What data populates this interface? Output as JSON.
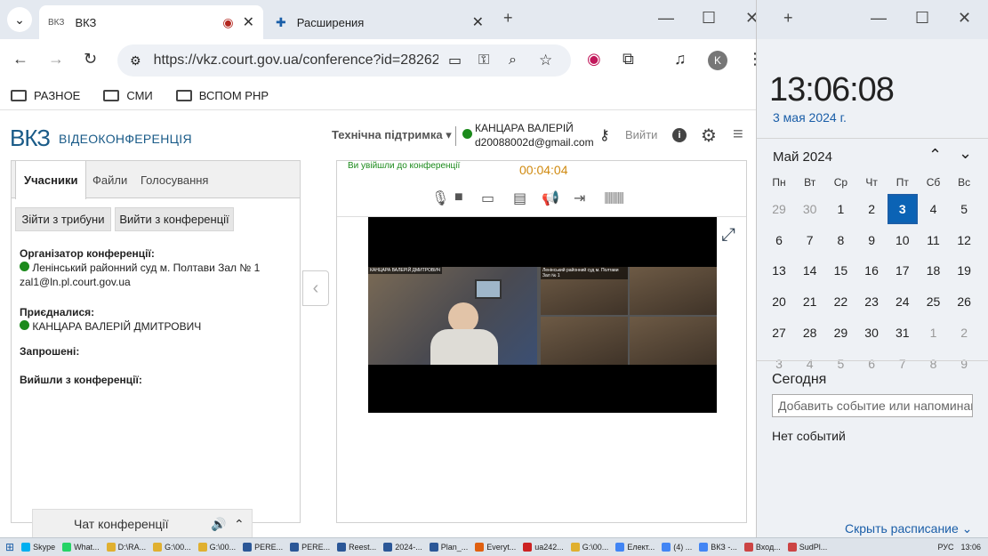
{
  "browser": {
    "tabs": [
      {
        "favicon": "ВКЗ",
        "title": "ВКЗ",
        "active": true
      },
      {
        "favicon": "puzzle-icon",
        "title": "Расширения",
        "active": false
      }
    ],
    "url": "https://vkz.court.gov.ua/conference?id=28262...",
    "profile_initial": "K",
    "bookmarks": [
      "РАЗНОЕ",
      "СМИ",
      "ВСПОМ РНР"
    ]
  },
  "header": {
    "logo": "ВКЗ",
    "logo_sub": "ВІДЕОКОНФЕРЕНЦІЯ",
    "support": "Технічна підтримка ▾",
    "user_name": "КАНЦАРА ВАЛЕРІЙ",
    "user_email": "d20088002d@gmail.com",
    "logout": "Вийти"
  },
  "participants_panel": {
    "tabs": [
      "Учасники",
      "Файли",
      "Голосування"
    ],
    "btn_leave_tribune": "Зійти з трибуни",
    "btn_leave_conf": "Вийти з конференції",
    "organizer_label": "Організатор конференції:",
    "organizer_name": "Ленінський районний суд м. Полтави Зал № 1",
    "organizer_email": "zal1@ln.pl.court.gov.ua",
    "joined_label": "Приєдналися:",
    "joined_name": "КАНЦАРА ВАЛЕРІЙ ДМИТРОВИЧ",
    "invited_label": "Запрошені:",
    "left_label": "Вийшли з конференції:"
  },
  "conference": {
    "status": "Ви увійшли до конференції",
    "timer": "00:04:04",
    "cam_label_self": "КАНЦАРА ВАЛЕРІЙ ДМИТРОВИЧ",
    "cam_label_court": "Ленінський районний суд м. Полтави Зал № 1"
  },
  "chat": {
    "title": "Чат конференції"
  },
  "calendar": {
    "time": "13:06:08",
    "date": "3 мая 2024 г.",
    "month": "Май 2024",
    "weekdays": [
      "Пн",
      "Вт",
      "Ср",
      "Чт",
      "Пт",
      "Сб",
      "Вс"
    ],
    "weeks": [
      [
        "29",
        "30",
        "1",
        "2",
        "3",
        "4",
        "5"
      ],
      [
        "6",
        "7",
        "8",
        "9",
        "10",
        "11",
        "12"
      ],
      [
        "13",
        "14",
        "15",
        "16",
        "17",
        "18",
        "19"
      ],
      [
        "20",
        "21",
        "22",
        "23",
        "24",
        "25",
        "26"
      ],
      [
        "27",
        "28",
        "29",
        "30",
        "31",
        "1",
        "2"
      ],
      [
        "3",
        "4",
        "5",
        "6",
        "7",
        "8",
        "9"
      ]
    ],
    "today_label": "Сегодня",
    "event_placeholder": "Добавить событие или напоминание",
    "no_events": "Нет событий",
    "hide_schedule": "Скрыть расписание ⌄"
  },
  "taskbar": {
    "items": [
      "Skype",
      "What...",
      "D:\\RA...",
      "G:\\00...",
      "G:\\00...",
      "PERE...",
      "PERE...",
      "Reest...",
      "2024-...",
      "Plan_...",
      "Everyt...",
      "ua242...",
      "G:\\00...",
      "Елект...",
      "(4) ...",
      "ВКЗ -...",
      "Вход...",
      "SudPl..."
    ],
    "lang": "РУС",
    "clock": "13:06"
  }
}
